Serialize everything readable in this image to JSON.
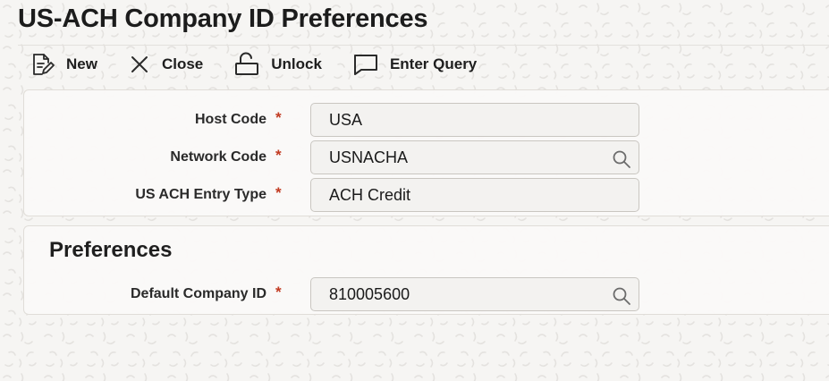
{
  "page": {
    "title": "US-ACH Company ID Preferences"
  },
  "toolbar": {
    "new_label": "New",
    "close_label": "Close",
    "unlock_label": "Unlock",
    "enter_query_label": "Enter Query"
  },
  "main": {
    "host_code": {
      "label": "Host Code",
      "value": "USA"
    },
    "network_code": {
      "label": "Network Code",
      "value": "USNACHA"
    },
    "entry_type": {
      "label": "US ACH Entry Type",
      "value": "ACH Credit"
    }
  },
  "preferences": {
    "section_title": "Preferences",
    "default_company_id": {
      "label": "Default Company ID",
      "value": "810005600"
    }
  },
  "required_marker": "*",
  "colors": {
    "required": "#c23b22",
    "background": "#f6f5f3",
    "panel": "#faf9f8",
    "input_bg": "#f3f2f0"
  },
  "icons": [
    "new-document-icon",
    "close-icon",
    "unlock-icon",
    "chat-bubble-icon",
    "search-icon"
  ]
}
